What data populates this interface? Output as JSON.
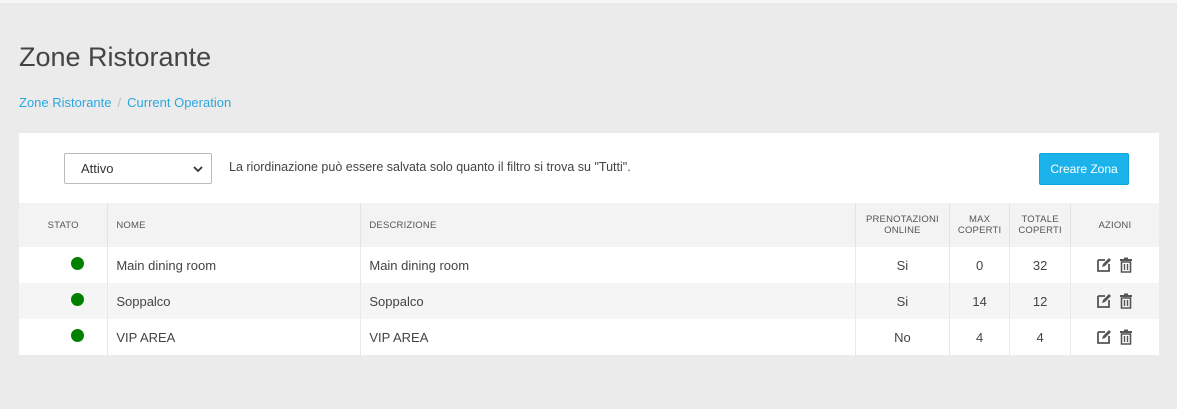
{
  "page": {
    "title": "Zone Ristorante",
    "breadcrumb": [
      "Zone Ristorante",
      "Current Operation"
    ],
    "breadcrumb_separator": "/"
  },
  "toolbar": {
    "filter_value": "Attivo",
    "filter_chevron": "⌄",
    "note": "La riordinazione può essere salvata solo quanto il filtro si trova su \"Tutti\".",
    "create_label": "Creare Zona",
    "create_color": "#1cb3ea"
  },
  "table": {
    "headers": {
      "stato": "STATO",
      "nome": "NOME",
      "descrizione": "DESCRIZIONE",
      "prenotazioni_1": "PRENOTAZIONI",
      "prenotazioni_2": "ONLINE",
      "max_1": "MAX",
      "max_2": "COPERTI",
      "totale_1": "TOTALE",
      "totale_2": "COPERTI",
      "azioni": "AZIONI"
    },
    "rows": [
      {
        "status_color": "#008000",
        "nome": "Main dining room",
        "descrizione": "Main dining room",
        "online": "Si",
        "max": "0",
        "totale": "32"
      },
      {
        "status_color": "#008000",
        "nome": "Soppalco",
        "descrizione": "Soppalco",
        "online": "Si",
        "max": "14",
        "totale": "12"
      },
      {
        "status_color": "#008000",
        "nome": "VIP AREA",
        "descrizione": "VIP AREA",
        "online": "No",
        "max": "4",
        "totale": "4"
      }
    ],
    "action_icons": [
      "edit-icon",
      "trash-icon"
    ]
  }
}
